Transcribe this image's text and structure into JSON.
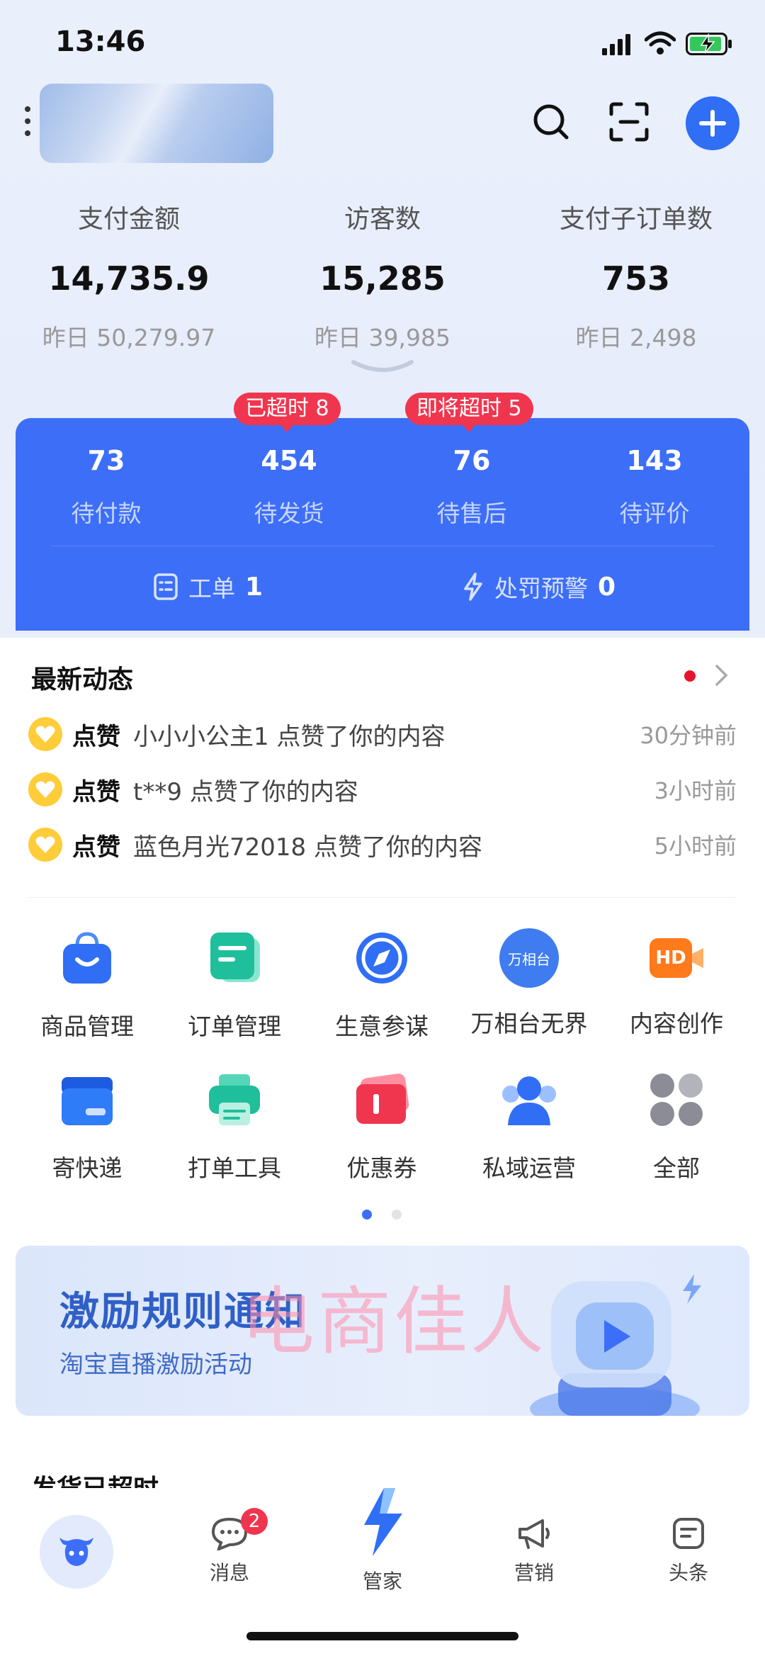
{
  "status_bar": {
    "time": "13:46"
  },
  "header": {
    "shop_name": "",
    "search_icon": "search-icon",
    "scan_icon": "scan-icon",
    "add_icon": "plus-icon"
  },
  "stats": [
    {
      "label": "支付金额",
      "value": "14,735.9",
      "prev": "昨日 50,279.97"
    },
    {
      "label": "访客数",
      "value": "15,285",
      "prev": "昨日 39,985"
    },
    {
      "label": "支付子订单数",
      "value": "753",
      "prev": "昨日 2,498"
    }
  ],
  "orders": {
    "items": [
      {
        "count": "73",
        "label": "待付款"
      },
      {
        "count": "454",
        "label": "待发货"
      },
      {
        "count": "76",
        "label": "待售后"
      },
      {
        "count": "143",
        "label": "待评价"
      }
    ],
    "alerts": {
      "overdue": "已超时 8",
      "soon": "即将超时 5"
    },
    "ticket": {
      "label": "工单",
      "count": "1"
    },
    "penalty": {
      "label": "处罚预警",
      "count": "0"
    }
  },
  "activity": {
    "title": "最新动态",
    "items": [
      {
        "type": "点赞",
        "msg": "小小小公主1 点赞了你的内容",
        "time": "30分钟前"
      },
      {
        "type": "点赞",
        "msg": "t**9 点赞了你的内容",
        "time": "3小时前"
      },
      {
        "type": "点赞",
        "msg": "蓝色月光72018 点赞了你的内容",
        "time": "5小时前"
      }
    ]
  },
  "tools": {
    "row1": [
      {
        "label": "商品管理",
        "icon": "shopping-bag-icon"
      },
      {
        "label": "订单管理",
        "icon": "order-doc-icon"
      },
      {
        "label": "生意参谋",
        "icon": "compass-icon"
      },
      {
        "label": "万相台无界",
        "icon": "wanxiangtai-logo-icon",
        "logo_text": "万相台"
      },
      {
        "label": "内容创作",
        "icon": "hd-camera-icon",
        "logo_text": "HD"
      }
    ],
    "row2": [
      {
        "label": "寄快递",
        "icon": "express-box-icon"
      },
      {
        "label": "打单工具",
        "icon": "printer-icon"
      },
      {
        "label": "优惠券",
        "icon": "coupon-icon"
      },
      {
        "label": "私域运营",
        "icon": "users-icon"
      },
      {
        "label": "全部",
        "icon": "grid-dots-icon"
      }
    ]
  },
  "banner": {
    "title": "激励规则通知",
    "subtitle": "淘宝直播激励活动",
    "watermark": "电商佳人"
  },
  "late_section": {
    "title": "发货已超时"
  },
  "tabbar": {
    "home_icon": "cow-head-icon",
    "tabs": [
      {
        "label": "消息",
        "badge": "2"
      },
      {
        "label": "管家"
      },
      {
        "label": "营销"
      },
      {
        "label": "头条"
      }
    ]
  },
  "colors": {
    "accent": "#3d6ef7",
    "alert": "#f0364f",
    "heart": "#ffcc3a"
  }
}
